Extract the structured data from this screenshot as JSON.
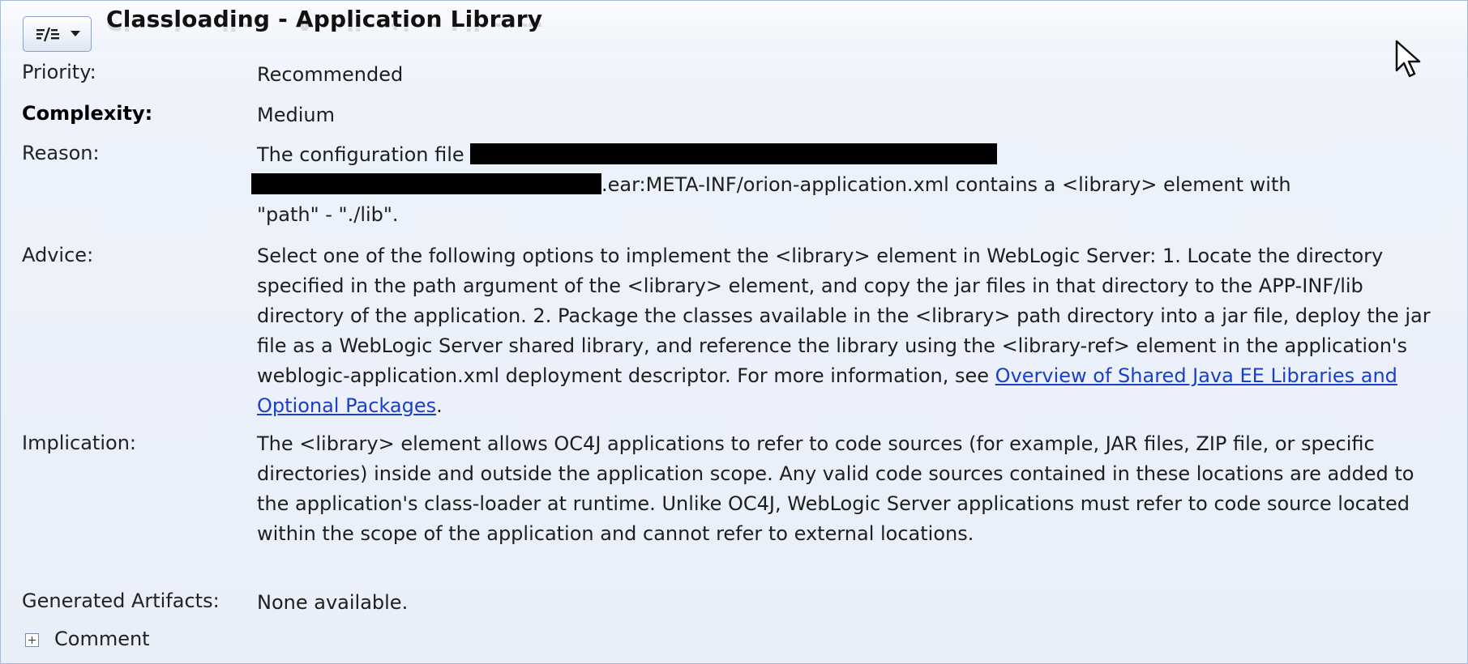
{
  "header": {
    "view_menu_icon": "view-options-icon",
    "title": "Classloading - Application Library"
  },
  "fields": {
    "priority": {
      "label": "Priority:",
      "value": "Recommended"
    },
    "complexity": {
      "label": "Complexity:",
      "value": "Medium"
    },
    "reason": {
      "label": "Reason:",
      "line1_prefix": "The configuration file",
      "line2_suffix": ".ear:META-INF/orion-application.xml contains a <library> element with",
      "line3": "\"path\" - \"./lib\"."
    },
    "advice": {
      "label": "Advice:",
      "text": "Select one of the following options to implement the <library> element in WebLogic Server: 1. Locate the directory specified in the path argument of the <library> element, and copy the jar files in that directory to the APP-INF/lib directory of the application. 2. Package the classes available in the <library> path directory into a jar file, deploy the jar file as a WebLogic Server shared library, and reference the library using the <library-ref> element in the application's weblogic-application.xml deployment descriptor. For more information, see ",
      "link_text": "Overview of Shared Java EE Libraries and Optional Packages",
      "trailing": "."
    },
    "implication": {
      "label": "Implication:",
      "text": "The <library> element allows OC4J applications to refer to code sources (for example, JAR files, ZIP file, or specific directories) inside and outside the application scope. Any valid code sources contained in these locations are added to the application's class-loader at runtime. Unlike OC4J, WebLogic Server applications must refer to code source located within the scope of the application and cannot refer to external locations."
    },
    "generated_artifacts": {
      "label": "Generated Artifacts:",
      "value": "None available."
    }
  },
  "comment": {
    "label": "Comment",
    "icon": "expand-plus-icon"
  }
}
